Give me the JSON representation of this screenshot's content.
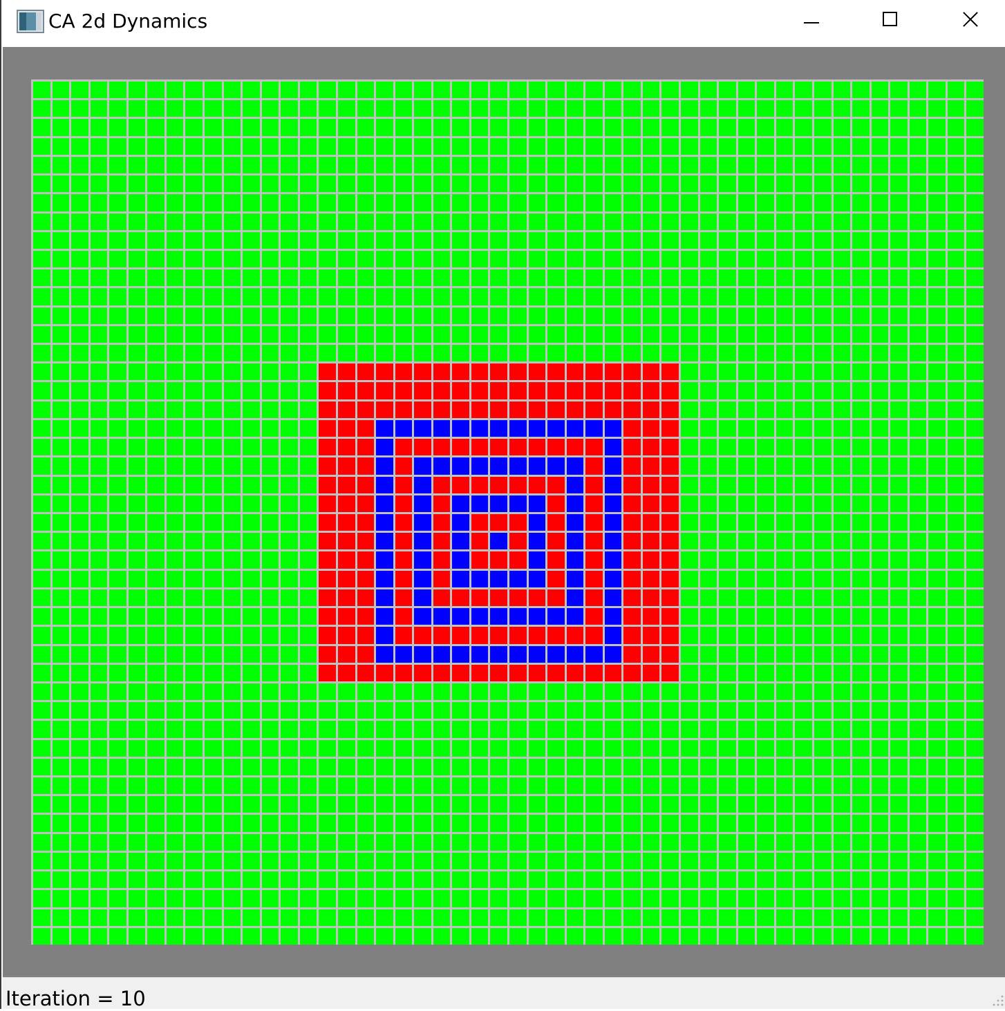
{
  "window": {
    "title": "CA 2d Dynamics",
    "controls": [
      "minimize-icon",
      "maximize-icon",
      "close-icon"
    ]
  },
  "status": {
    "iteration_text": "Iteration = 10"
  },
  "automaton": {
    "columns": 50,
    "rows": 46,
    "colors": {
      "background": "#808080",
      "grid_line": "#c0c0c0",
      "green": "#00ff00",
      "red": "#ff0000",
      "blue": "#0000ff"
    },
    "red_region": {
      "col_start": 15,
      "col_end": 33,
      "row_start": 15,
      "row_end": 31
    },
    "blue_cells": [
      [
        18,
        18
      ],
      [
        19,
        18
      ],
      [
        20,
        18
      ],
      [
        21,
        18
      ],
      [
        22,
        18
      ],
      [
        23,
        18
      ],
      [
        24,
        18
      ],
      [
        25,
        18
      ],
      [
        26,
        18
      ],
      [
        27,
        18
      ],
      [
        28,
        18
      ],
      [
        29,
        18
      ],
      [
        30,
        18
      ],
      [
        18,
        19
      ],
      [
        30,
        19
      ],
      [
        18,
        20
      ],
      [
        20,
        20
      ],
      [
        21,
        20
      ],
      [
        22,
        20
      ],
      [
        23,
        20
      ],
      [
        24,
        20
      ],
      [
        25,
        20
      ],
      [
        26,
        20
      ],
      [
        27,
        20
      ],
      [
        28,
        20
      ],
      [
        30,
        20
      ],
      [
        18,
        21
      ],
      [
        20,
        21
      ],
      [
        28,
        21
      ],
      [
        30,
        21
      ],
      [
        18,
        22
      ],
      [
        20,
        22
      ],
      [
        22,
        22
      ],
      [
        23,
        22
      ],
      [
        24,
        22
      ],
      [
        25,
        22
      ],
      [
        26,
        22
      ],
      [
        28,
        22
      ],
      [
        30,
        22
      ],
      [
        18,
        23
      ],
      [
        20,
        23
      ],
      [
        22,
        23
      ],
      [
        26,
        23
      ],
      [
        28,
        23
      ],
      [
        30,
        23
      ],
      [
        18,
        24
      ],
      [
        20,
        24
      ],
      [
        22,
        24
      ],
      [
        24,
        24
      ],
      [
        26,
        24
      ],
      [
        28,
        24
      ],
      [
        30,
        24
      ],
      [
        18,
        25
      ],
      [
        20,
        25
      ],
      [
        22,
        25
      ],
      [
        26,
        25
      ],
      [
        28,
        25
      ],
      [
        30,
        25
      ],
      [
        18,
        26
      ],
      [
        20,
        26
      ],
      [
        22,
        26
      ],
      [
        23,
        26
      ],
      [
        24,
        26
      ],
      [
        25,
        26
      ],
      [
        26,
        26
      ],
      [
        28,
        26
      ],
      [
        30,
        26
      ],
      [
        18,
        27
      ],
      [
        20,
        27
      ],
      [
        28,
        27
      ],
      [
        30,
        27
      ],
      [
        18,
        28
      ],
      [
        20,
        28
      ],
      [
        21,
        28
      ],
      [
        22,
        28
      ],
      [
        23,
        28
      ],
      [
        24,
        28
      ],
      [
        25,
        28
      ],
      [
        26,
        28
      ],
      [
        27,
        28
      ],
      [
        28,
        28
      ],
      [
        30,
        28
      ],
      [
        18,
        29
      ],
      [
        30,
        29
      ],
      [
        18,
        30
      ],
      [
        19,
        30
      ],
      [
        20,
        30
      ],
      [
        21,
        30
      ],
      [
        22,
        30
      ],
      [
        23,
        30
      ],
      [
        24,
        30
      ],
      [
        25,
        30
      ],
      [
        26,
        30
      ],
      [
        27,
        30
      ],
      [
        28,
        30
      ],
      [
        29,
        30
      ],
      [
        30,
        30
      ]
    ]
  }
}
